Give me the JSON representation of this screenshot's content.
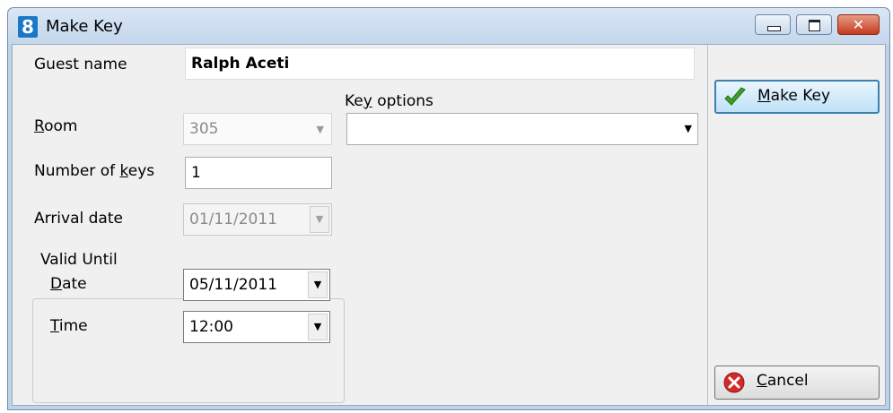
{
  "window": {
    "title": "Make Key",
    "app_icon_text": "8",
    "close_glyph": "✕"
  },
  "form": {
    "guest_name_label": "Guest name",
    "guest_name_value": "Ralph Aceti",
    "key_options_label_pre": "Ke",
    "key_options_label_u": "y",
    "key_options_label_post": " options",
    "key_options_value": "",
    "room_label_u": "R",
    "room_label_rest": "oom",
    "room_value": "305",
    "num_keys_label_pre": "Number of ",
    "num_keys_label_u": "k",
    "num_keys_label_post": "eys",
    "num_keys_value": "1",
    "arrival_label": "Arrival date",
    "arrival_value": "01/11/2011",
    "valid_until_label": "Valid Until",
    "date_label_u": "D",
    "date_label_rest": "ate",
    "date_value": "05/11/2011",
    "time_label_u": "T",
    "time_label_rest": "ime",
    "time_value": "12:00"
  },
  "buttons": {
    "make_key_u": "M",
    "make_key_rest": "ake Key",
    "cancel_u": "C",
    "cancel_rest": "ancel"
  },
  "icons": {
    "dropdown_arrow": "▼",
    "app_icon_color": "#1a78c8",
    "check_color": "#3aa321",
    "cancel_color": "#d22a2a"
  }
}
